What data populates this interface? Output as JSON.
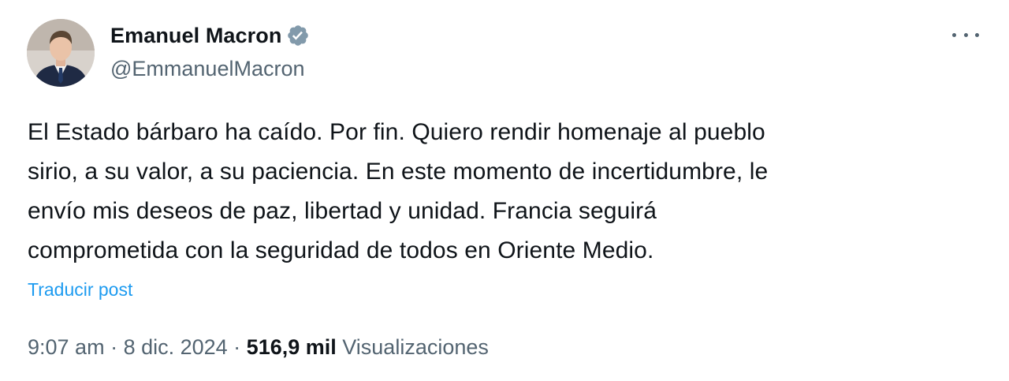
{
  "author": {
    "display_name": "Emanuel Macron",
    "handle": "@EmmanuelMacron",
    "verified_icon": "verified-badge-icon",
    "avatar": "profile-photo"
  },
  "menu": {
    "icon": "more-options-icon"
  },
  "post": {
    "lines": [
      "El Estado bárbaro ha caído. Por fin. Quiero rendir homenaje al pueblo",
      "sirio, a su valor, a su paciencia. En este momento de incertidumbre, le",
      "envío mis deseos de paz, libertad y unidad. Francia seguirá",
      "comprometida con la seguridad de todos en Oriente Medio."
    ],
    "translate_label": "Traducir post"
  },
  "meta": {
    "time": "9:07 am",
    "sep1": " · ",
    "date": "8 dic. 2024",
    "sep2": " · ",
    "views_count": "516,9 mil",
    "views_label": "Visualizaciones"
  },
  "colors": {
    "text": "#0f1419",
    "secondary": "#536471",
    "link": "#1d9bf0",
    "verified": "#829aab"
  }
}
